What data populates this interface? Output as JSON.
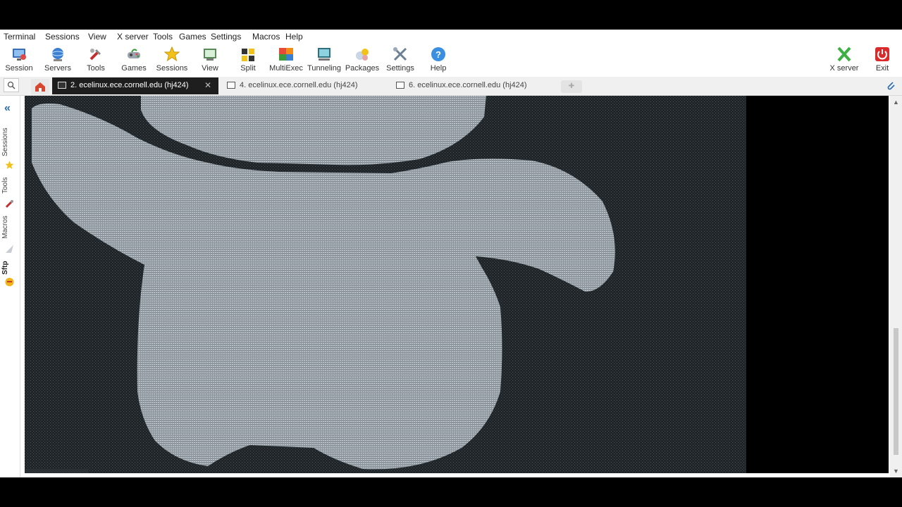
{
  "menubar": {
    "items": [
      "Terminal",
      "Sessions",
      "View",
      "X server",
      "Tools",
      "Games",
      "Settings",
      "Macros",
      "Help"
    ]
  },
  "toolbar": {
    "buttons": [
      {
        "label": "Session",
        "icon": "session-icon"
      },
      {
        "label": "Servers",
        "icon": "servers-icon"
      },
      {
        "label": "Tools",
        "icon": "tools-icon"
      },
      {
        "label": "Games",
        "icon": "games-icon"
      },
      {
        "label": "Sessions",
        "icon": "star-icon"
      },
      {
        "label": "View",
        "icon": "view-icon"
      },
      {
        "label": "Split",
        "icon": "split-icon"
      },
      {
        "label": "MultiExec",
        "icon": "multiexec-icon"
      },
      {
        "label": "Tunneling",
        "icon": "tunneling-icon"
      },
      {
        "label": "Packages",
        "icon": "packages-icon"
      },
      {
        "label": "Settings",
        "icon": "settings-icon"
      },
      {
        "label": "Help",
        "icon": "help-icon"
      }
    ],
    "right": [
      {
        "label": "X server",
        "icon": "x-server-icon"
      },
      {
        "label": "Exit",
        "icon": "power-icon"
      }
    ]
  },
  "tabs": [
    {
      "label": "2. ecelinux.ece.cornell.edu (hj424)",
      "active": true
    },
    {
      "label": "4. ecelinux.ece.cornell.edu (hj424)",
      "active": false
    },
    {
      "label": "6. ecelinux.ece.cornell.edu (hj424)",
      "active": false
    }
  ],
  "sidebar": {
    "labels": [
      "Sessions",
      "Tools",
      "Macros",
      "Sftp"
    ]
  },
  "terminal": {
    "fg": "#b8c2c8",
    "bg": "#000000",
    "art": "ascii-art-image"
  },
  "colors": {
    "tab_active_bg": "#1e1e1e",
    "accent": "#2b6cb0",
    "exit_red": "#d92b2b",
    "xserver_green": "#3cb043"
  }
}
